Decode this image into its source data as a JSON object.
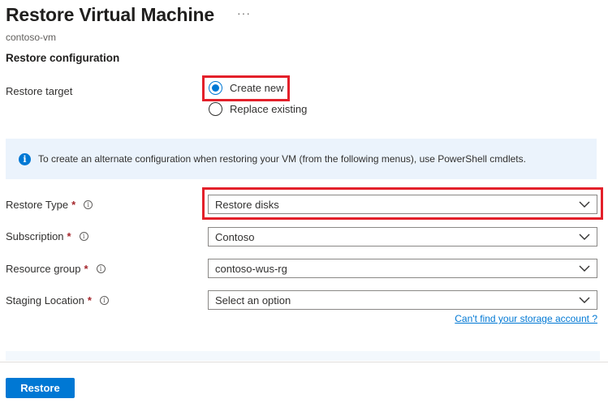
{
  "header": {
    "title": "Restore Virtual Machine",
    "more_label": "···",
    "subtitle": "contoso-vm"
  },
  "section": {
    "title": "Restore configuration"
  },
  "restore_target": {
    "label": "Restore target",
    "options": [
      {
        "label": "Create new",
        "checked": true
      },
      {
        "label": "Replace existing",
        "checked": false
      }
    ]
  },
  "banner": {
    "icon": "info-icon",
    "text": "To create an alternate configuration when restoring your VM (from the following menus), use PowerShell cmdlets."
  },
  "fields": {
    "restore_type": {
      "label": "Restore Type",
      "required": "*",
      "value": "Restore disks"
    },
    "subscription": {
      "label": "Subscription",
      "required": "*",
      "value": "Contoso"
    },
    "resource_group": {
      "label": "Resource group",
      "required": "*",
      "value": "contoso-wus-rg"
    },
    "staging_location": {
      "label": "Staging Location",
      "required": "*",
      "value": "Select an option"
    }
  },
  "storage_link": "Can't find your storage account ?",
  "footer": {
    "restore_button": "Restore"
  },
  "colors": {
    "accent": "#0078d4",
    "highlight": "#e3202a",
    "banner_bg": "#ebf3fc",
    "required": "#a4262c"
  }
}
